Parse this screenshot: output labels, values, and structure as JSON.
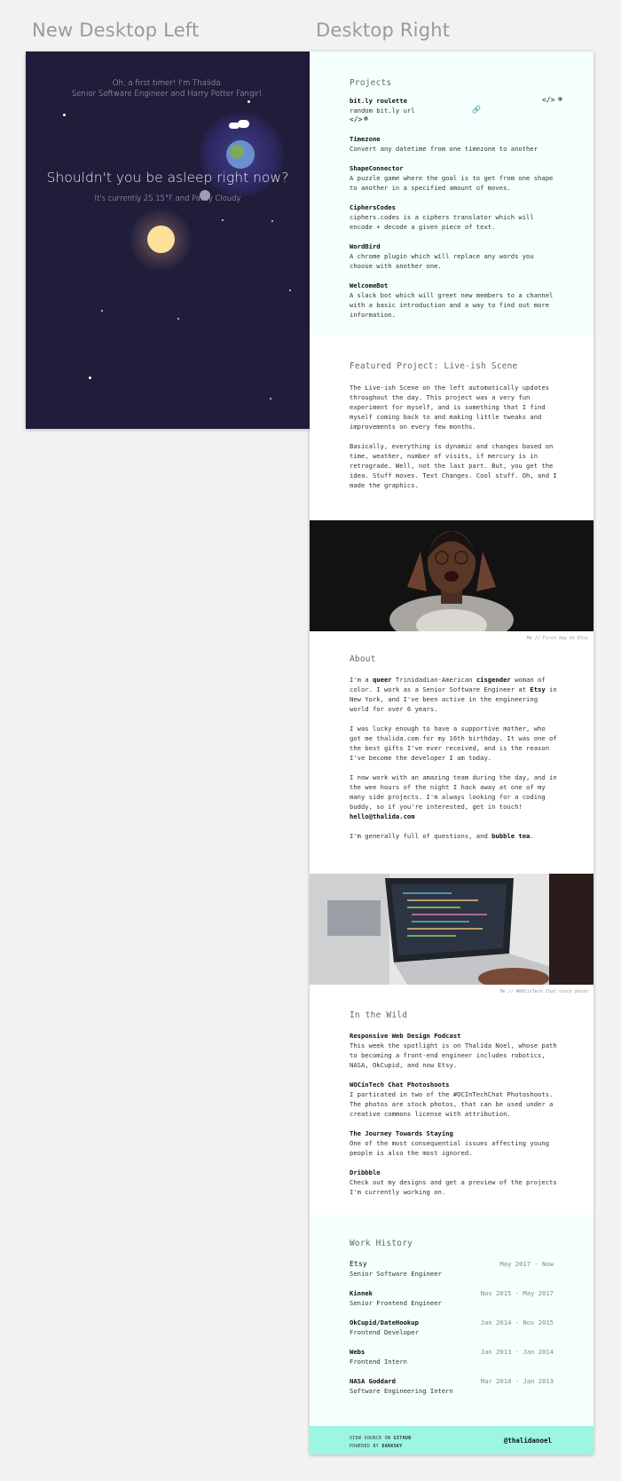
{
  "frames": {
    "left_label": "New Desktop Left",
    "right_label": "Desktop Right"
  },
  "scene": {
    "intro_line1": "Oh, a first timer! I'm Thalida.",
    "intro_line2": "Senior Software Engineer and Harry Potter Fangirl.",
    "headline": "Shouldn't you be asleep right now?",
    "weather": "It's currently 25.15°F and Partly Cloudy"
  },
  "projects": {
    "title": "Projects",
    "items": [
      {
        "name": "bit.ly roulette",
        "desc": "random bit.ly url"
      },
      {
        "name": "Timezone",
        "desc": "Convert any datetime from one timezone to another"
      },
      {
        "name": "ShapeConnector",
        "desc": "A puzzle game where the goal is to get from one shape to another in a specified amount of moves."
      },
      {
        "name": "CiphersCodes",
        "desc": "ciphers.codes is a ciphers translator which will encode + decode a given piece of text."
      },
      {
        "name": "WordBird",
        "desc": "A chrome plugin which will replace any words you choose with another one."
      },
      {
        "name": "WelcomeBot",
        "desc": "A slack bot which will greet new members to a channel with a basic introduction and a way to find out more information."
      }
    ],
    "icons": [
      "code-icon",
      "dribbble-icon",
      "link-icon"
    ]
  },
  "featured": {
    "title": "Featured Project: Live-ish Scene",
    "p1": "The Live-ish Scene on the left automatically updates throughout the day. This project was a very fun experiment for myself, and is something that I find myself coming back to and making little tweaks and improvements on every few months.",
    "p2": "Basically, everything is dynamic and changes based on time, weather, number of visits, if mercury is in retrograde. Well, not the last part. But, you get the idea. Stuff moves. Text Changes. Cool stuff. Oh, and I made the graphics."
  },
  "photo1": {
    "caption": "Me // First day at Etsy"
  },
  "about": {
    "title": "About",
    "p1_a": "I'm a ",
    "p1_b": "queer",
    "p1_c": " Trinidadian-American ",
    "p1_d": "cisgender",
    "p1_e": " woman of color. I work as a Senior Software Engineer at ",
    "p1_f": "Etsy",
    "p1_g": " in New York, and I've been active in the engineering world for over 6 years.",
    "p2": "I was lucky enough to have a supportive mother, who got me thalida.com for my 16th birthday. It was one of the best gifts I've ever received, and is the reason I've become the developer I am today.",
    "p3": "I now work with an amazing team during the day, and in the wee hours of the night I hack away at one of my many side projects. I'm always looking for a coding buddy, so if you're interested, get in touch!",
    "email": "hello@thalida.com",
    "p4_a": "I'm generally full of questions, and ",
    "p4_b": "bubble tea",
    "p4_c": "."
  },
  "photo2": {
    "caption": "Me // #WOCinTech Chat stock photo"
  },
  "wild": {
    "title": "In the Wild",
    "items": [
      {
        "name": "Responsive Web Design Podcast",
        "desc": "This week the spotlight is on Thalida Noel, whose path to becoming a front-end engineer includes robotics, NASA, OkCupid, and now Etsy."
      },
      {
        "name": "WOCinTech Chat Photoshoots",
        "desc": "I particated in two of the #OCInTechChat Photoshoots. The photos are stock photos, that can be used under a creative commons license with attribution."
      },
      {
        "name": "The Journey Towards Staying",
        "desc": "One of the most consequential issues affecting young people is also the most ignored."
      },
      {
        "name": "Dribbble",
        "desc": "Check out my designs and get a preview of the projects I'm currently working on."
      }
    ]
  },
  "work": {
    "title": "Work History",
    "jobs": [
      {
        "company": "Etsy",
        "role": "Senior Software Engineer",
        "dates": "May 2017 - Now"
      },
      {
        "company": "Kinnek",
        "role": "Senior Frontend Engineer",
        "dates": "Nov 2015 - May 2017"
      },
      {
        "company": "OkCupid/DateHookup",
        "role": "Frontend Developer",
        "dates": "Jan 2014 - Nov 2015"
      },
      {
        "company": "Webs",
        "role": "Frontend Intern",
        "dates": "Jan 2013 - Jan 2014"
      },
      {
        "company": "NASA Goddard",
        "role": "Software Engineering Intern",
        "dates": "Mar 2010 - Jan 2013"
      }
    ]
  },
  "footer": {
    "line1_a": "VIEW SOURCE ON ",
    "line1_b": "GITHUB",
    "line2_a": "POWERED BY ",
    "line2_b": "DARKSKY",
    "handle": "@thalidanoel"
  },
  "colors": {
    "scene_bg": "#201d3a",
    "tint": "#f5fffe",
    "footer": "#9cf6e1"
  }
}
